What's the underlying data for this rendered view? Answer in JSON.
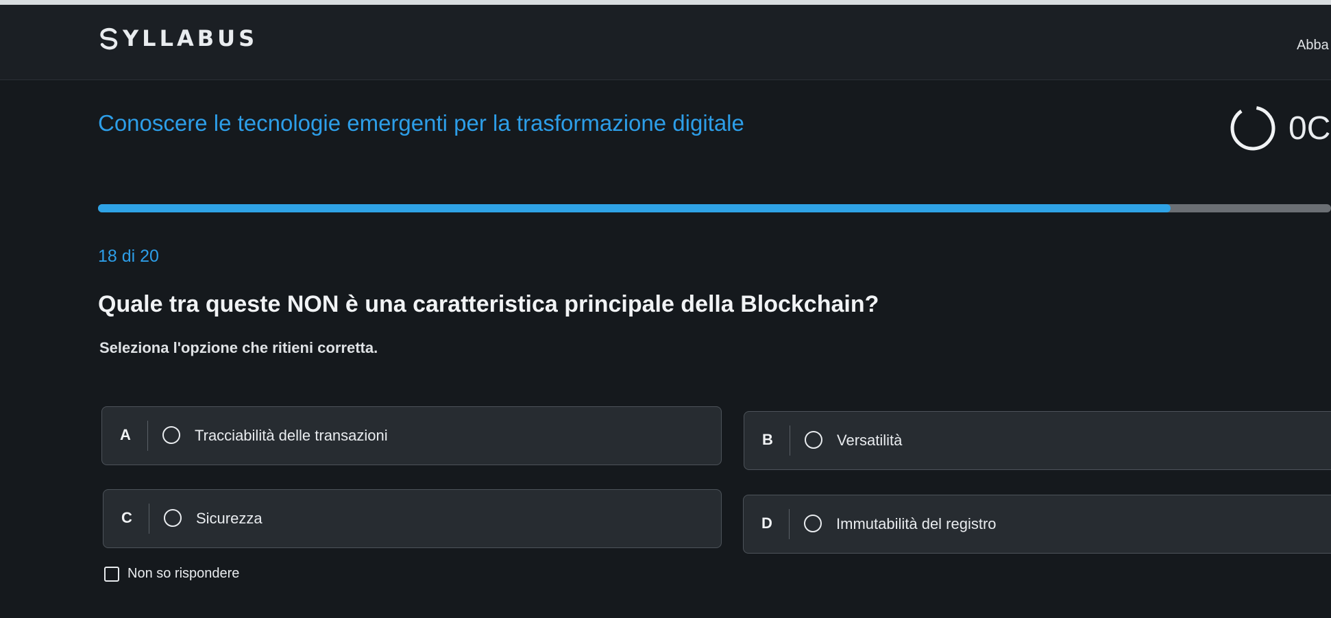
{
  "header": {
    "logo_text": "YLLABUS",
    "logo_mark": "syllabus-s-logo",
    "user_name": "Abba"
  },
  "course": {
    "title": "Conoscere le tecnologie emergenti per la trasformazione digitale",
    "timer_text": "0C",
    "progress_fraction": 0.87
  },
  "quiz": {
    "counter": "18 di 20",
    "question": "Quale tra queste NON è una caratteristica principale della Blockchain?",
    "instruction": "Seleziona l'opzione che ritieni corretta.",
    "options": [
      {
        "letter": "A",
        "label": "Tracciabilità delle transazioni"
      },
      {
        "letter": "B",
        "label": "Versatilità"
      },
      {
        "letter": "C",
        "label": "Sicurezza"
      },
      {
        "letter": "D",
        "label": "Immutabilità del registro"
      }
    ],
    "no_answer_label": "Non so rispondere"
  },
  "colors": {
    "accent": "#2d9ee8",
    "background": "#15191d",
    "card": "#272c31"
  }
}
